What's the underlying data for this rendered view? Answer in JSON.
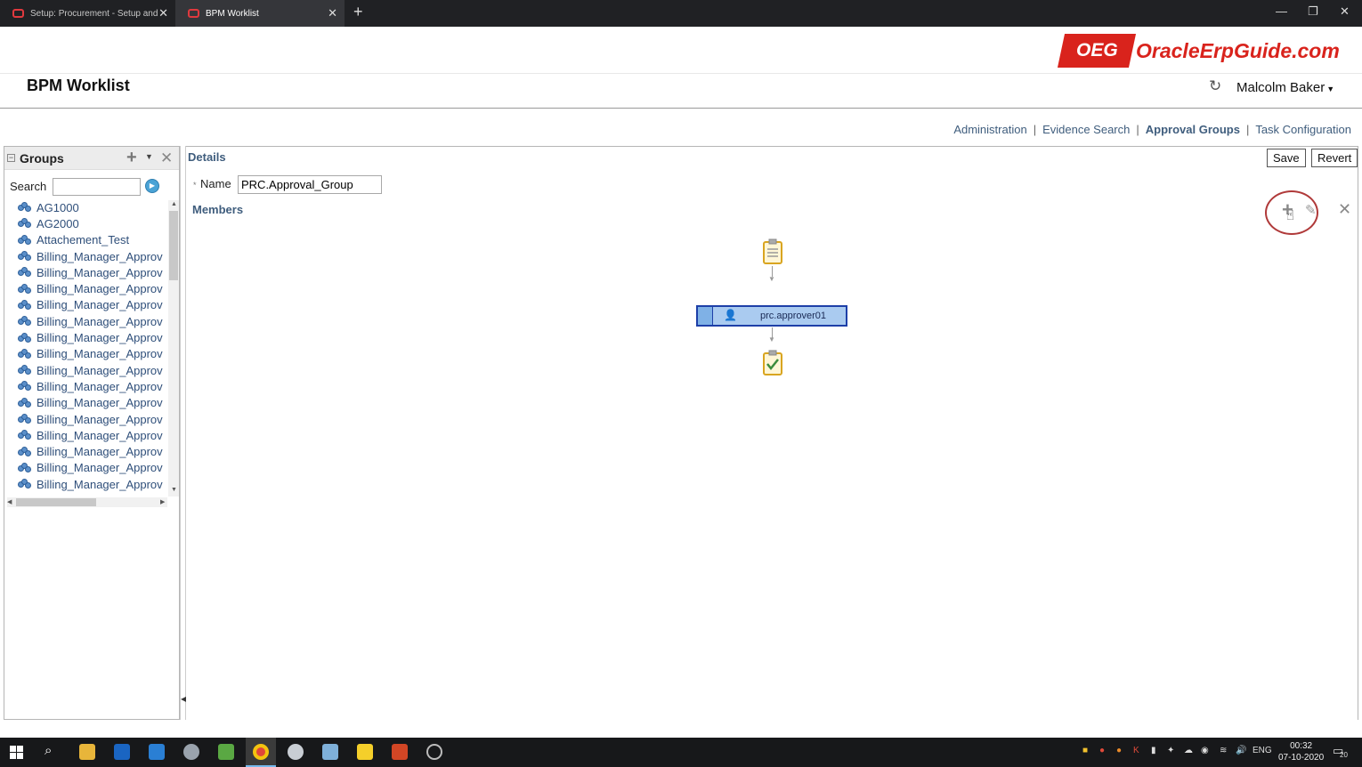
{
  "browser": {
    "tabs": [
      {
        "label": "Setup: Procurement - Setup and",
        "active": false
      },
      {
        "label": "BPM Worklist",
        "active": true
      }
    ]
  },
  "header": {
    "title": "BPM Worklist",
    "logo_mark": "OEG",
    "logo_text": "OracleErpGuide.com",
    "user_name": "Malcolm Baker",
    "brand_color": "#d9231c"
  },
  "topnav": {
    "items": [
      {
        "label": "Administration",
        "active": false
      },
      {
        "label": "Evidence Search",
        "active": false
      },
      {
        "label": "Approval Groups",
        "active": true
      },
      {
        "label": "Task Configuration",
        "active": false
      }
    ]
  },
  "groups_panel": {
    "title": "Groups",
    "search_label": "Search",
    "search_value": "",
    "items": [
      "AG1000",
      "AG2000",
      "Attachement_Test",
      "Billing_Manager_Approv",
      "Billing_Manager_Approv",
      "Billing_Manager_Approv",
      "Billing_Manager_Approv",
      "Billing_Manager_Approv",
      "Billing_Manager_Approv",
      "Billing_Manager_Approv",
      "Billing_Manager_Approv",
      "Billing_Manager_Approv",
      "Billing_Manager_Approv",
      "Billing_Manager_Approv",
      "Billing_Manager_Approv",
      "Billing_Manager_Approv",
      "Billing_Manager_Approv",
      "Billing_Manager_Approv"
    ]
  },
  "details": {
    "title": "Details",
    "save_label": "Save",
    "revert_label": "Revert",
    "required_mark": "*",
    "name_label": "Name",
    "name_value": "PRC.Approval_Group",
    "members_title": "Members",
    "members": [
      {
        "name": "prc.approver01"
      }
    ]
  },
  "taskbar": {
    "time": "00:32",
    "date": "07-10-2020",
    "language": "ENG",
    "notification_count": "20"
  }
}
